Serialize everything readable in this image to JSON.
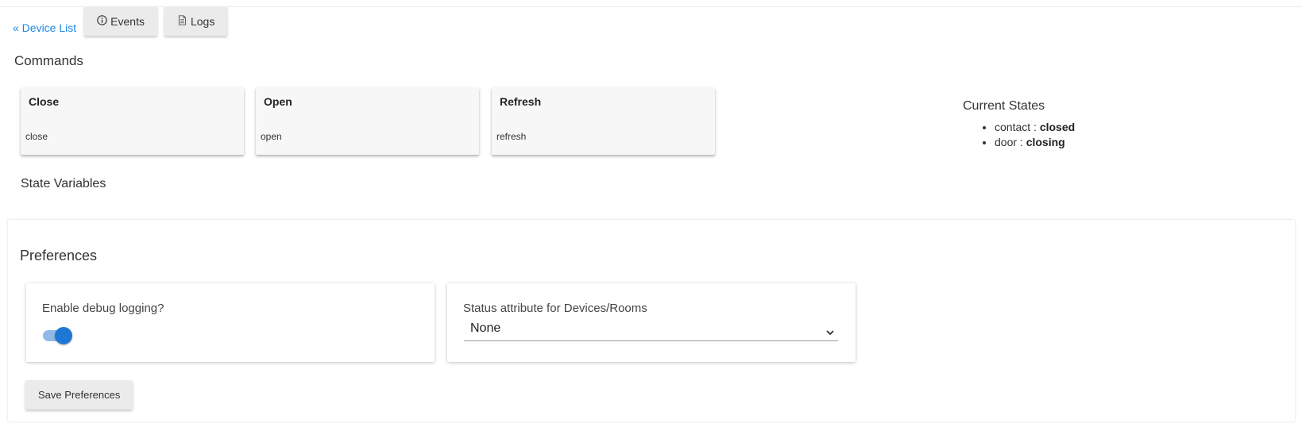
{
  "nav": {
    "back_label": "« Device List",
    "events_label": "Events",
    "logs_label": "Logs"
  },
  "commands": {
    "title": "Commands",
    "items": [
      {
        "name": "Close",
        "sub": "close"
      },
      {
        "name": "Open",
        "sub": "open"
      },
      {
        "name": "Refresh",
        "sub": "refresh"
      }
    ]
  },
  "current_states": {
    "title": "Current States",
    "items": [
      {
        "key": "contact : ",
        "value": "closed"
      },
      {
        "key": "door : ",
        "value": "closing"
      }
    ]
  },
  "state_variables": {
    "title": "State Variables"
  },
  "preferences": {
    "title": "Preferences",
    "debug": {
      "label": "Enable debug logging?",
      "enabled": true
    },
    "status_attr": {
      "label": "Status attribute for Devices/Rooms",
      "value": "None"
    },
    "save_label": "Save Preferences"
  },
  "colors": {
    "accent": "#1e77d3",
    "link": "#1e88e5",
    "button_bg": "#ebebeb"
  },
  "icons": {
    "events": "info-circle-icon",
    "logs": "document-icon",
    "select": "chevron-down-icon"
  }
}
